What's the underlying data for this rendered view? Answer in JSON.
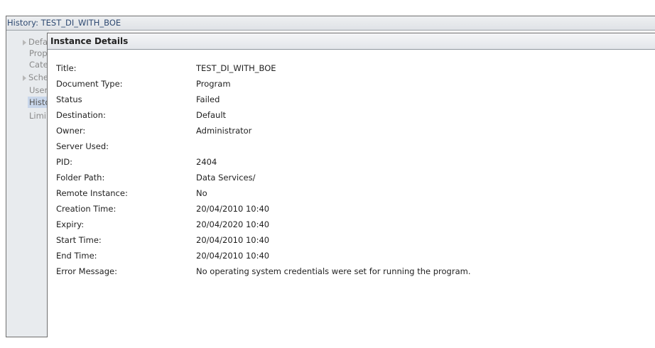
{
  "window": {
    "title": "History: TEST_DI_WITH_BOE"
  },
  "sidebar": {
    "items": [
      {
        "label": "Defa",
        "expander": true
      },
      {
        "label": "Prop",
        "expander": false
      },
      {
        "label": "Cate",
        "expander": false
      },
      {
        "label": "Sche",
        "expander": true
      },
      {
        "label": "User",
        "expander": false
      },
      {
        "label": "Histo",
        "expander": false,
        "selected": true
      },
      {
        "label": "Limi",
        "expander": false
      }
    ]
  },
  "dialog": {
    "title": "Instance Details",
    "rows": [
      {
        "label": "Title:",
        "value": "TEST_DI_WITH_BOE"
      },
      {
        "label": "Document Type:",
        "value": "Program"
      },
      {
        "label": "Status",
        "value": "Failed"
      },
      {
        "label": "Destination:",
        "value": "Default"
      },
      {
        "label": "Owner:",
        "value": "Administrator"
      },
      {
        "label": "Server Used:",
        "value": ""
      },
      {
        "label": "PID:",
        "value": "2404"
      },
      {
        "label": "Folder Path:",
        "value": "Data Services/"
      },
      {
        "label": "Remote Instance:",
        "value": "No"
      },
      {
        "label": "Creation Time:",
        "value": "20/04/2010 10:40"
      },
      {
        "label": "Expiry:",
        "value": "20/04/2020 10:40"
      },
      {
        "label": "Start Time:",
        "value": "20/04/2010 10:40"
      },
      {
        "label": "End Time:",
        "value": "20/04/2010 10:40"
      },
      {
        "label": "Error Message:",
        "value": "No operating system credentials were set for running the program."
      }
    ]
  }
}
